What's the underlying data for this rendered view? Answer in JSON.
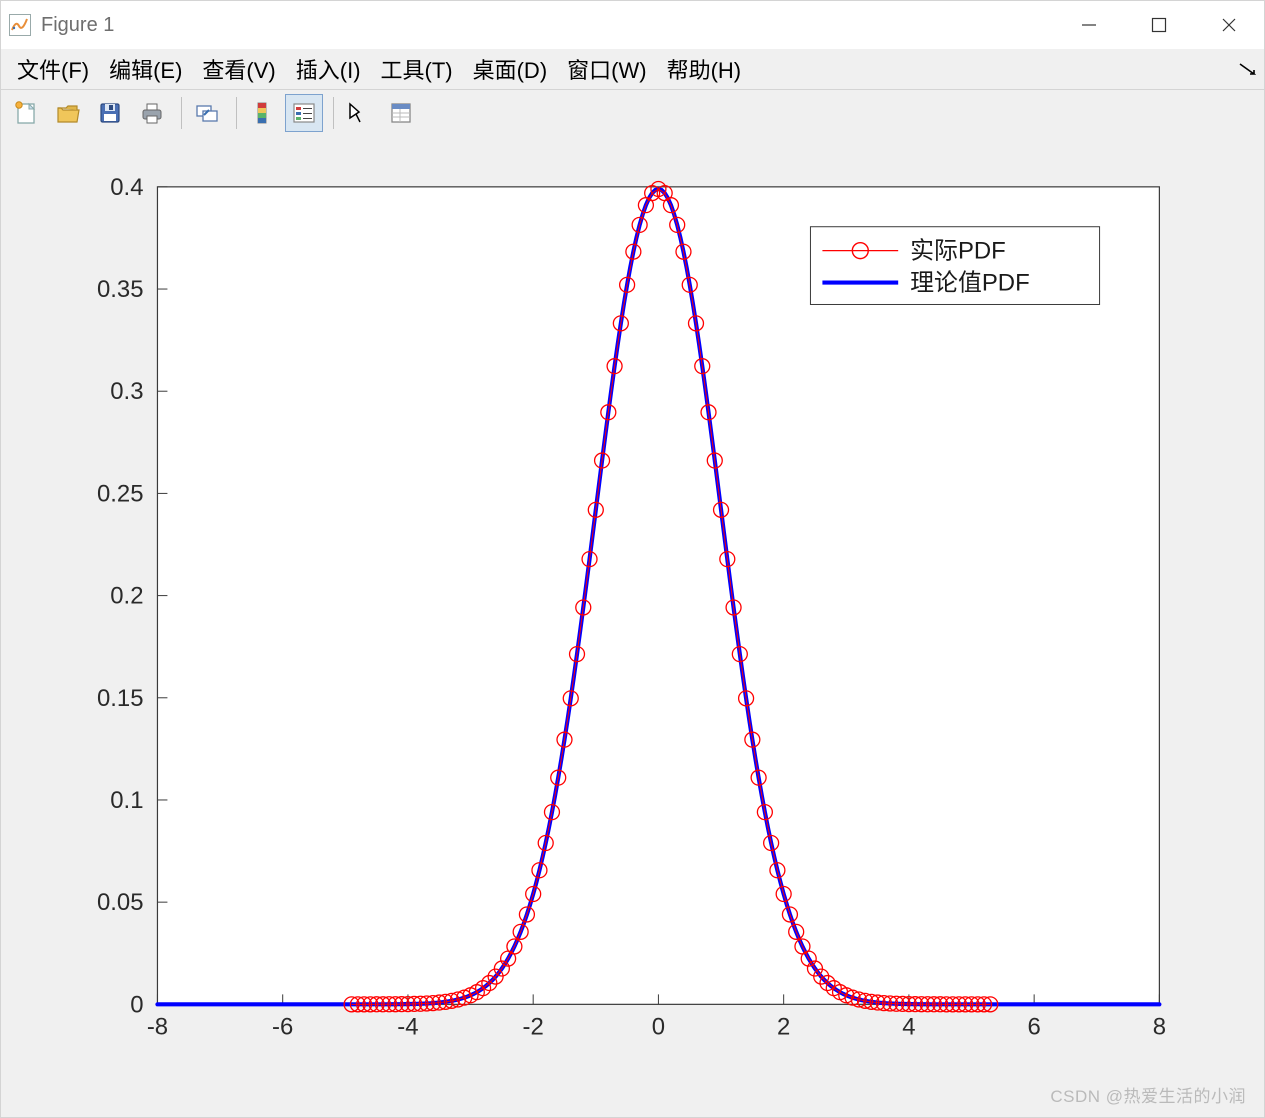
{
  "window": {
    "title": "Figure 1",
    "minimize_tooltip": "Minimize",
    "maximize_tooltip": "Maximize",
    "close_tooltip": "Close"
  },
  "menu": {
    "file": "文件(F)",
    "edit": "编辑(E)",
    "view": "查看(V)",
    "insert": "插入(I)",
    "tools": "工具(T)",
    "desktop": "桌面(D)",
    "window": "窗口(W)",
    "help": "帮助(H)"
  },
  "toolbar": {
    "new": "New Figure",
    "open": "Open File",
    "save": "Save Figure",
    "print": "Print Figure",
    "link": "Link Plot",
    "colorbar": "Insert Colorbar",
    "legend": "Insert Legend",
    "edit_plot": "Edit Plot",
    "inspector": "Property Inspector"
  },
  "watermark": "CSDN @热爱生活的小润",
  "chart_data": {
    "type": "line",
    "title": "",
    "xlabel": "",
    "ylabel": "",
    "xlim": [
      -8,
      8
    ],
    "ylim": [
      0,
      0.4
    ],
    "xticks": [
      -8,
      -6,
      -4,
      -2,
      0,
      2,
      4,
      6,
      8
    ],
    "yticks": [
      0,
      0.05,
      0.1,
      0.15,
      0.2,
      0.25,
      0.3,
      0.35,
      0.4
    ],
    "legend": {
      "position": "upper-right"
    },
    "series": [
      {
        "name": "实际PDF",
        "style": "circle-marker",
        "color": "#ff0000",
        "linewidth": 0.8,
        "x_range": [
          -4.9,
          5.3
        ],
        "x_step": 0.1,
        "y_formula": "normal_pdf(mu=0,sigma=1)",
        "sample_values": [
          [
            -4.9,
            2.4e-06
          ],
          [
            -4.0,
            0.000134
          ],
          [
            -3.5,
            0.000873
          ],
          [
            -3.0,
            0.00443
          ],
          [
            -2.5,
            0.01753
          ],
          [
            -2.0,
            0.05399
          ],
          [
            -1.5,
            0.12952
          ],
          [
            -1.0,
            0.24197
          ],
          [
            -0.5,
            0.35207
          ],
          [
            0.0,
            0.39894
          ],
          [
            0.5,
            0.35207
          ],
          [
            1.0,
            0.24197
          ],
          [
            1.5,
            0.12952
          ],
          [
            2.0,
            0.05399
          ],
          [
            2.5,
            0.01753
          ],
          [
            3.0,
            0.00443
          ],
          [
            3.5,
            0.000873
          ],
          [
            4.0,
            0.000134
          ],
          [
            5.0,
            1.5e-06
          ],
          [
            5.3,
            4.1e-07
          ]
        ]
      },
      {
        "name": "理论值PDF",
        "style": "solid-line",
        "color": "#0000ff",
        "linewidth": 3.2,
        "x_range": [
          -8,
          8
        ],
        "x_step": 0.05,
        "y_formula": "normal_pdf(mu=0,sigma=1)",
        "sample_values": [
          [
            -8,
            5.1e-15
          ],
          [
            -6,
            6.1e-09
          ],
          [
            -4,
            0.000134
          ],
          [
            -3,
            0.00443
          ],
          [
            -2,
            0.05399
          ],
          [
            -1,
            0.24197
          ],
          [
            0,
            0.39894
          ],
          [
            1,
            0.24197
          ],
          [
            2,
            0.05399
          ],
          [
            3,
            0.00443
          ],
          [
            4,
            0.000134
          ],
          [
            6,
            6.1e-09
          ],
          [
            8,
            5.1e-15
          ]
        ]
      }
    ]
  }
}
